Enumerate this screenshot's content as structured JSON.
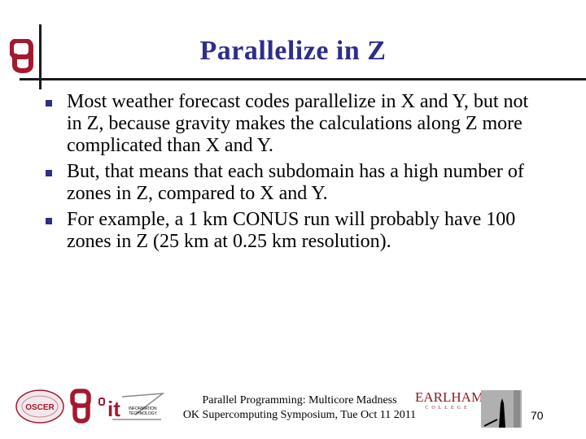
{
  "slide": {
    "title": "Parallelize in Z",
    "bullets": [
      "Most weather forecast codes parallelize in X and Y, but not in Z, because gravity makes the calculations along Z more complicated than X and Y.",
      "But, that means that each subdomain has a high number of zones in Z, compared to X and Y.",
      "For example, a 1 km CONUS run will probably have 100 zones in Z (25 km at 0.25 km resolution)."
    ],
    "footer": {
      "line1": "Parallel Programming: Multicore Madness",
      "line2": "OK Supercomputing Symposium, Tue Oct 11 2011",
      "page_number": "70"
    },
    "logos": {
      "oscer": "OSCER",
      "it_main": "it",
      "it_sub1": "INFORMATION",
      "it_sub2": "TECHNOLOGY",
      "earlham_name": "EARLHAM",
      "earlham_sub": "COLLEGE"
    },
    "colors": {
      "title": "#2e2e8a",
      "ou_crimson": "#a3192e",
      "earlham": "#8b1a1a"
    }
  }
}
